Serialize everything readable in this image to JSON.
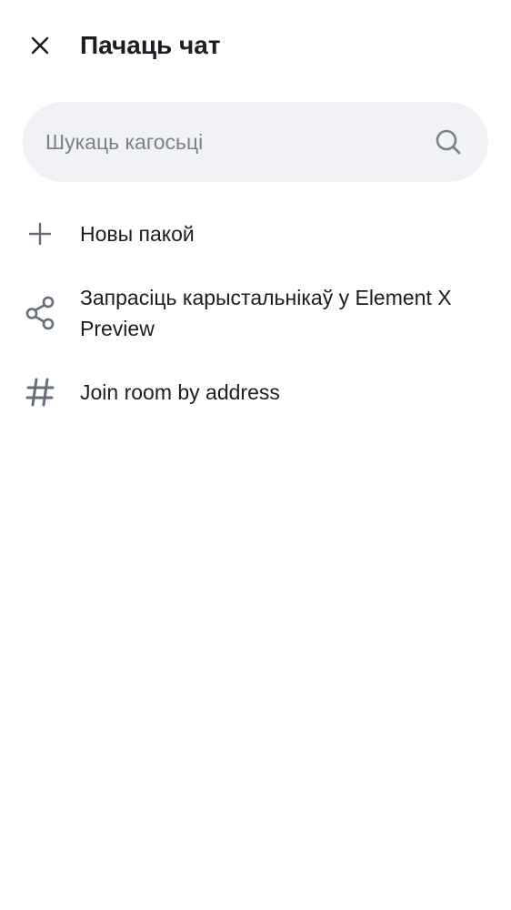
{
  "header": {
    "title": "Пачаць чат",
    "close_icon": "close-icon"
  },
  "search": {
    "placeholder": "Шукаць кагосьці",
    "value": "",
    "icon": "search-icon"
  },
  "actions": [
    {
      "label": "Новы пакой",
      "icon": "plus-icon"
    },
    {
      "label": "Запрасіць карыстальнікаў у Element X Preview",
      "icon": "share-icon"
    },
    {
      "label": "Join room by address",
      "icon": "hash-icon"
    }
  ],
  "colors": {
    "background": "#ffffff",
    "text_primary": "#1b1d22",
    "text_secondary": "#7b808a",
    "icon": "#656d77",
    "search_background": "#f0f2f5"
  }
}
